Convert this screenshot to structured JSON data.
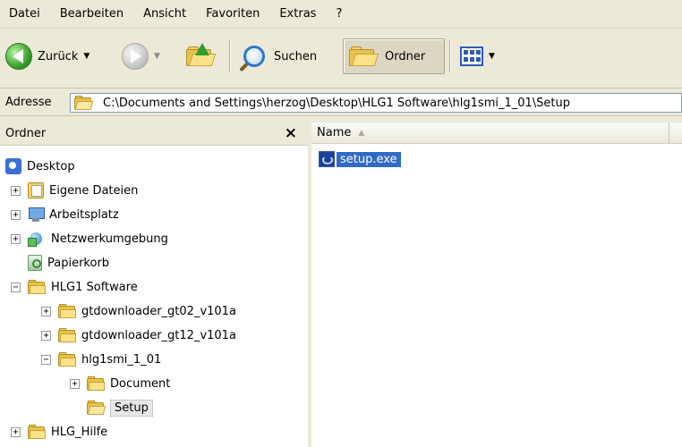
{
  "menubar": {
    "items": [
      {
        "label": "Datei"
      },
      {
        "label": "Bearbeiten"
      },
      {
        "label": "Ansicht"
      },
      {
        "label": "Favoriten"
      },
      {
        "label": "Extras"
      },
      {
        "label": "?"
      }
    ]
  },
  "toolbar": {
    "back_label": "Zurück",
    "search_label": "Suchen",
    "folders_label": "Ordner"
  },
  "address": {
    "label": "Adresse",
    "value": "C:\\Documents and Settings\\herzog\\Desktop\\HLG1 Software\\hlg1smi_1_01\\Setup"
  },
  "left_pane": {
    "title": "Ordner",
    "close": "×",
    "tree": [
      {
        "label": "Desktop",
        "icon": "desktop-icon",
        "expander": ""
      },
      {
        "label": "Eigene Dateien",
        "icon": "my-documents-icon",
        "expander": "+"
      },
      {
        "label": "Arbeitsplatz",
        "icon": "my-computer-icon",
        "expander": "+"
      },
      {
        "label": "Netzwerkumgebung",
        "icon": "network-icon",
        "expander": "+"
      },
      {
        "label": "Papierkorb",
        "icon": "recycle-bin-icon",
        "expander": ""
      },
      {
        "label": "HLG1 Software",
        "icon": "folder-icon",
        "expander": "−"
      },
      {
        "label": "gtdownloader_gt02_v101a",
        "icon": "folder-icon",
        "expander": "+"
      },
      {
        "label": "gtdownloader_gt12_v101a",
        "icon": "folder-icon",
        "expander": "+"
      },
      {
        "label": "hlg1smi_1_01",
        "icon": "folder-icon",
        "expander": "−"
      },
      {
        "label": "Document",
        "icon": "folder-icon",
        "expander": "+"
      },
      {
        "label": "Setup",
        "icon": "open-folder-icon",
        "expander": ""
      },
      {
        "label": "HLG_Hilfe",
        "icon": "folder-icon",
        "expander": "+"
      }
    ]
  },
  "right_pane": {
    "column_name": "Name",
    "sort_indicator": "▲",
    "files": [
      {
        "name": "setup.exe",
        "icon": "setup-exe-icon"
      }
    ]
  }
}
